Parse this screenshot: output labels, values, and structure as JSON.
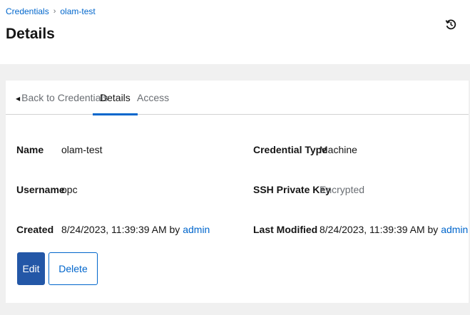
{
  "breadcrumb": {
    "parent": "Credentials",
    "separator": "›",
    "current": "olam-test"
  },
  "page": {
    "title": "Details"
  },
  "tabs": {
    "back": "Back to Credentials",
    "details": "Details",
    "access": "Access"
  },
  "details": {
    "name_label": "Name",
    "name_value": "olam-test",
    "username_label": "Username",
    "username_value": "opc",
    "created_label": "Created",
    "created_value": "8/24/2023, 11:39:39 AM by",
    "created_by": "admin",
    "credential_type_label": "Credential Type",
    "credential_type_value": "Machine",
    "ssh_key_label": "SSH Private Key",
    "ssh_key_value": "Encrypted",
    "modified_label": "Last Modified",
    "modified_value": "8/24/2023, 11:39:39 AM by",
    "modified_by": "admin"
  },
  "actions": {
    "edit": "Edit",
    "delete": "Delete"
  },
  "colors": {
    "accent": "#0066cc",
    "primary_button": "#2357a7",
    "background": "#f0f0f0"
  }
}
